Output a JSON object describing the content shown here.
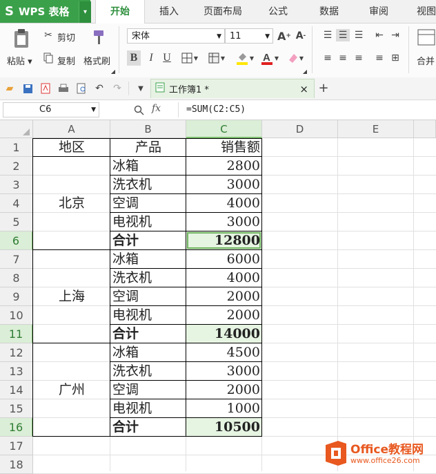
{
  "app": {
    "logo_glyph": "S",
    "name": "WPS 表格",
    "menu_arrow": "▾",
    "brand_color": "#3aa049"
  },
  "ribbon_tabs": [
    "开始",
    "插入",
    "页面布局",
    "公式",
    "数据",
    "审阅",
    "视图"
  ],
  "active_tab": "开始",
  "clipboard": {
    "paste": "粘贴",
    "cut": "剪切",
    "copy": "复制",
    "format_painter": "格式刷"
  },
  "font": {
    "name": "宋体",
    "size": "11"
  },
  "buttons": {
    "bold": "B",
    "italic": "I",
    "underline": "U",
    "merge": "合并"
  },
  "document": {
    "tab_title": "工作簿1 *",
    "close_glyph": "×",
    "new_tab_glyph": "+"
  },
  "formula_bar": {
    "name_box": "C6",
    "fx": "fx",
    "formula": "=SUM(C2:C5)"
  },
  "columns": [
    "A",
    "B",
    "C",
    "D",
    "E"
  ],
  "selected_column": "C",
  "rows": [
    "1",
    "2",
    "3",
    "4",
    "5",
    "6",
    "7",
    "8",
    "9",
    "10",
    "11",
    "12",
    "13",
    "14",
    "15",
    "16",
    "17",
    "18"
  ],
  "selected_rows": [
    "6",
    "11",
    "16"
  ],
  "sheet": {
    "header": {
      "region": "地区",
      "product": "产品",
      "sales": "销售额"
    },
    "groups": [
      {
        "region": "北京",
        "items": [
          {
            "product": "冰箱",
            "sales": "2800"
          },
          {
            "product": "洗衣机",
            "sales": "3000"
          },
          {
            "product": "空调",
            "sales": "4000"
          },
          {
            "product": "电视机",
            "sales": "3000"
          }
        ],
        "total_label": "合计",
        "total": "12800"
      },
      {
        "region": "上海",
        "items": [
          {
            "product": "冰箱",
            "sales": "6000"
          },
          {
            "product": "洗衣机",
            "sales": "4000"
          },
          {
            "product": "空调",
            "sales": "2000"
          },
          {
            "product": "电视机",
            "sales": "2000"
          }
        ],
        "total_label": "合计",
        "total": "14000"
      },
      {
        "region": "广州",
        "items": [
          {
            "product": "冰箱",
            "sales": "4500"
          },
          {
            "product": "洗衣机",
            "sales": "3000"
          },
          {
            "product": "空调",
            "sales": "2000"
          },
          {
            "product": "电视机",
            "sales": "1000"
          }
        ],
        "total_label": "合计",
        "total": "10500"
      }
    ]
  },
  "watermark": {
    "brand": "Office教程网",
    "url": "www.office26.com"
  }
}
